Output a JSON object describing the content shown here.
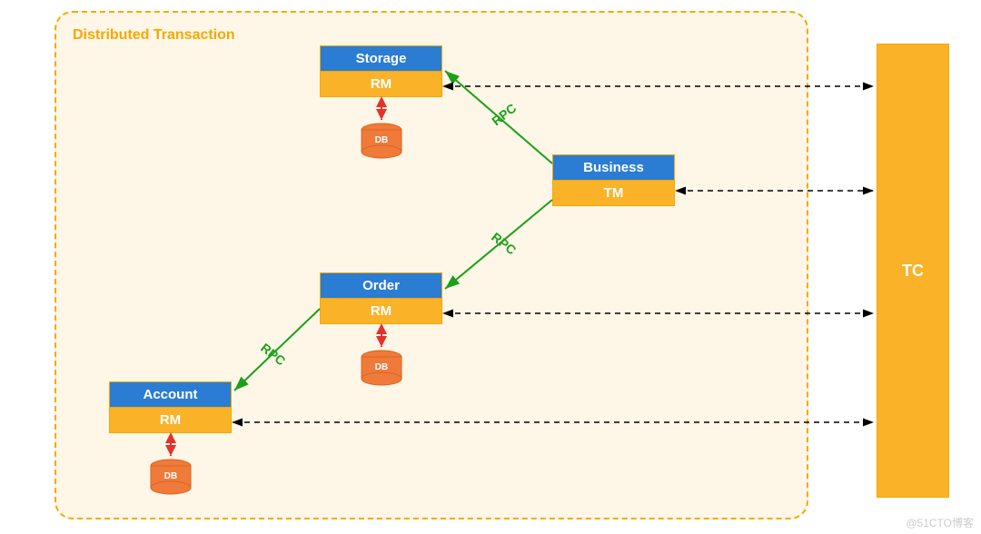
{
  "diagram_title": "Distributed Transaction",
  "services": {
    "storage": {
      "name": "Storage",
      "role": "RM",
      "db_label": "DB"
    },
    "business": {
      "name": "Business",
      "role": "TM"
    },
    "order": {
      "name": "Order",
      "role": "RM",
      "db_label": "DB"
    },
    "account": {
      "name": "Account",
      "role": "RM",
      "db_label": "DB"
    }
  },
  "coordinator": {
    "label": "TC"
  },
  "edges": {
    "rpc1": "RPC",
    "rpc2": "RPC",
    "rpc3": "RPC"
  },
  "watermark": "@51CTO博客"
}
